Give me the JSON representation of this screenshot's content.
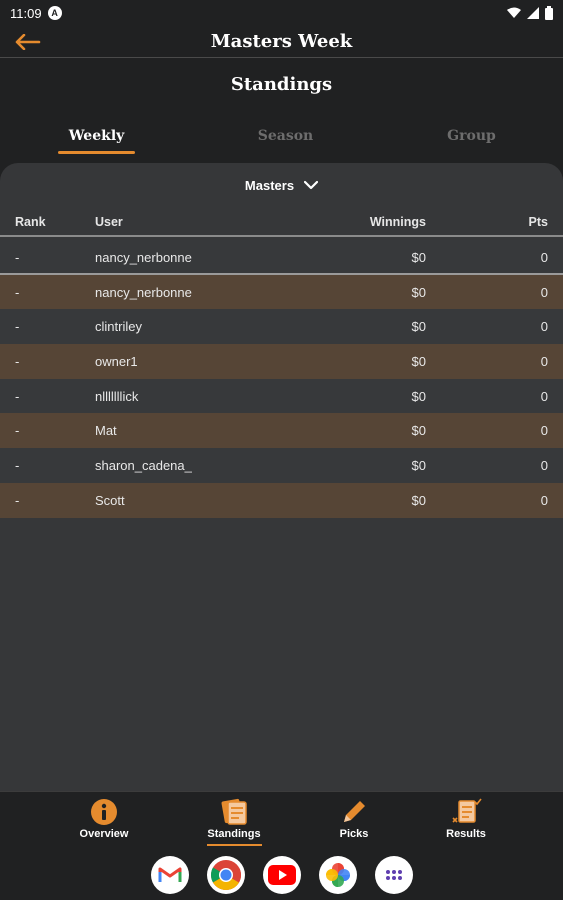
{
  "status_bar": {
    "time": "11:09",
    "notification_icon": "A"
  },
  "app_bar": {
    "title": "Masters Week"
  },
  "page": {
    "title": "Standings"
  },
  "tabs": [
    {
      "label": "Weekly",
      "active": true
    },
    {
      "label": "Season",
      "active": false
    },
    {
      "label": "Group",
      "active": false
    }
  ],
  "dropdown": {
    "selected": "Masters"
  },
  "table": {
    "headers": {
      "rank": "Rank",
      "user": "User",
      "winnings": "Winnings",
      "pts": "Pts"
    },
    "rows": [
      {
        "rank": "-",
        "user": "nancy_nerbonne",
        "winnings": "$0",
        "pts": "0"
      },
      {
        "rank": "-",
        "user": "nancy_nerbonne",
        "winnings": "$0",
        "pts": "0"
      },
      {
        "rank": "-",
        "user": "clintriley",
        "winnings": "$0",
        "pts": "0"
      },
      {
        "rank": "-",
        "user": "owner1",
        "winnings": "$0",
        "pts": "0"
      },
      {
        "rank": "-",
        "user": "nlllllllick",
        "winnings": "$0",
        "pts": "0"
      },
      {
        "rank": "-",
        "user": "Mat",
        "winnings": "$0",
        "pts": "0"
      },
      {
        "rank": "-",
        "user": "sharon_cadena_",
        "winnings": "$0",
        "pts": "0"
      },
      {
        "rank": "-",
        "user": "Scott",
        "winnings": "$0",
        "pts": "0"
      }
    ]
  },
  "bottom_nav": [
    {
      "label": "Overview",
      "icon": "info-icon"
    },
    {
      "label": "Standings",
      "icon": "standings-icon",
      "active": true
    },
    {
      "label": "Picks",
      "icon": "pencil-icon"
    },
    {
      "label": "Results",
      "icon": "results-icon"
    }
  ],
  "dock": [
    "gmail-icon",
    "chrome-icon",
    "youtube-icon",
    "photos-icon",
    "app-drawer-icon"
  ],
  "colors": {
    "accent": "#e58b2e",
    "background": "#202122",
    "panel": "#363739",
    "row_alt": "#564536"
  }
}
